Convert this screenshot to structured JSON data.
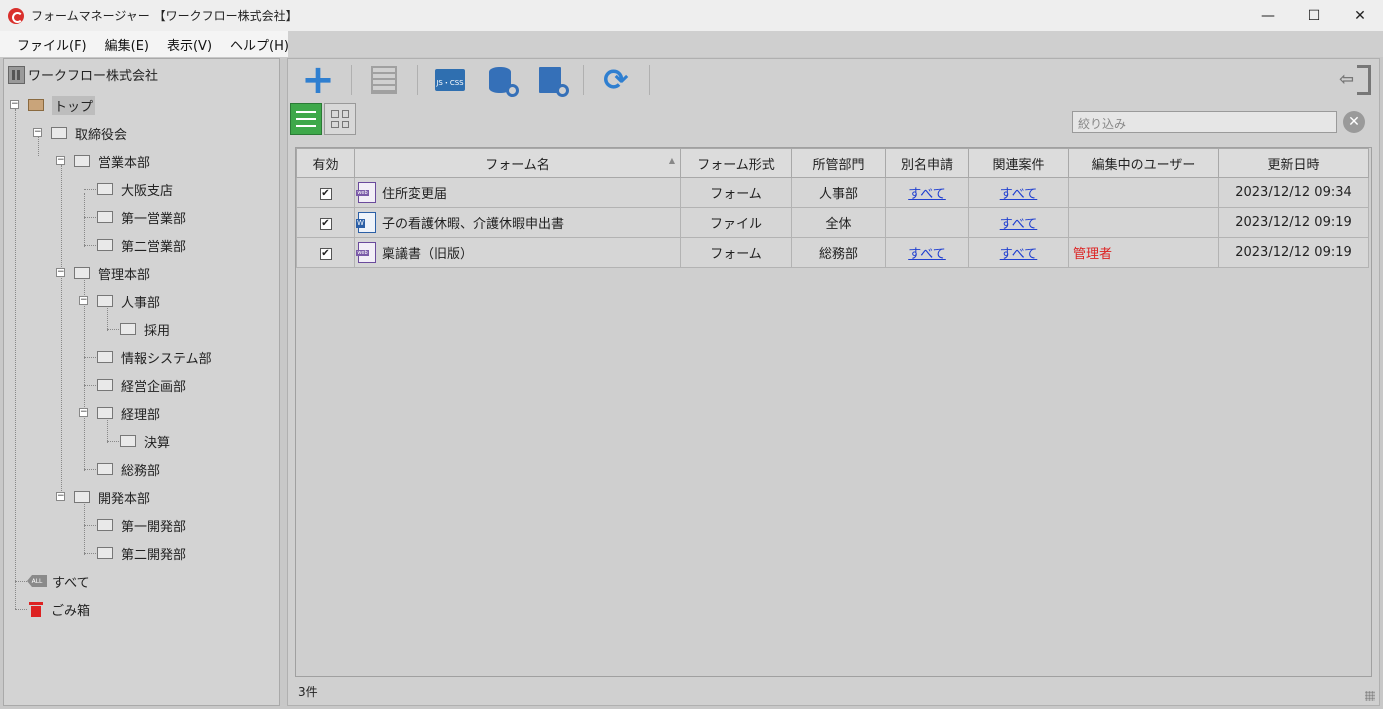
{
  "window": {
    "title": "フォームマネージャー 【ワークフロー株式会社】",
    "minimize": "—",
    "maximize": "☐",
    "close": "✕"
  },
  "menu": [
    "ファイル(F)",
    "編集(E)",
    "表示(V)",
    "ヘルプ(H)"
  ],
  "tree": {
    "company": "ワークフロー株式会社",
    "nodes": [
      {
        "label": "トップ",
        "expander": "−"
      },
      {
        "label": "取締役会",
        "expander": "−"
      },
      {
        "label": "営業本部",
        "expander": "−"
      },
      {
        "label": "大阪支店"
      },
      {
        "label": "第一営業部"
      },
      {
        "label": "第二営業部"
      },
      {
        "label": "管理本部",
        "expander": "−"
      },
      {
        "label": "人事部",
        "expander": "−"
      },
      {
        "label": "採用"
      },
      {
        "label": "情報システム部"
      },
      {
        "label": "経営企画部"
      },
      {
        "label": "経理部",
        "expander": "−"
      },
      {
        "label": "決算"
      },
      {
        "label": "総務部"
      },
      {
        "label": "開発本部",
        "expander": "−"
      },
      {
        "label": "第一開発部"
      },
      {
        "label": "第二開発部"
      },
      {
        "label": "すべて",
        "icon_text": "ALL"
      },
      {
        "label": "ごみ箱"
      }
    ]
  },
  "toolbar": {
    "css_icon_text": "JS・CSS",
    "add": "+",
    "refresh": "⟳",
    "exit_arrow": "⇦"
  },
  "filter": {
    "placeholder": "絞り込み",
    "clear": "✕"
  },
  "table": {
    "sort_indicator": "▲",
    "headers": [
      "有効",
      "フォーム名",
      "フォーム形式",
      "所管部門",
      "別名申請",
      "関連案件",
      "編集中のユーザー",
      "更新日時"
    ],
    "rows": [
      {
        "valid": "✔",
        "icon": "web",
        "name": "住所変更届",
        "type": "フォーム",
        "dept": "人事部",
        "alias": "すべて",
        "related": "すべて",
        "editing_user": "",
        "updated": "2023/12/12 09:34"
      },
      {
        "valid": "✔",
        "icon": "W",
        "name": "子の看護休暇、介護休暇申出書",
        "type": "ファイル",
        "dept": "全体",
        "alias": "",
        "related": "すべて",
        "editing_user": "",
        "updated": "2023/12/12 09:19"
      },
      {
        "valid": "✔",
        "icon": "web",
        "name": "稟議書（旧版）",
        "type": "フォーム",
        "dept": "総務部",
        "alias": "すべて",
        "related": "すべて",
        "editing_user": "管理者",
        "updated": "2023/12/12 09:19"
      }
    ]
  },
  "status": {
    "count": "3件"
  },
  "colors": {
    "accent": "#2f7fd0",
    "list_view_active": "#3ea84a",
    "editing_user": "#dd2222",
    "link": "#1f3fd0"
  }
}
